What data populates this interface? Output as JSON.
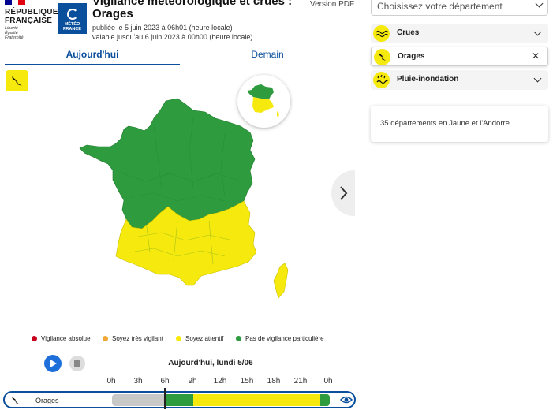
{
  "header": {
    "republic_name_line1": "RÉPUBLIQUE",
    "republic_name_line2": "FRANÇAISE",
    "motto_1": "Liberté",
    "motto_2": "Égalité",
    "motto_3": "Fraternité",
    "meteo_logo_line1": "MÉTÉO",
    "meteo_logo_line2": "FRANCE",
    "title": "Vigilance météorologique et crues :",
    "subtitle": "Orages",
    "published": "publiée le 5 juin 2023 à 06h01 (heure locale)",
    "valid_until": "valable jusqu'au 6 juin 2023 à 00h00 (heure locale)",
    "pdf_link": "Version PDF"
  },
  "tabs": [
    {
      "label": "Aujourd'hui",
      "active": true
    },
    {
      "label": "Demain",
      "active": false
    }
  ],
  "legend": [
    {
      "label": "Vigilance absolue",
      "color": "#c8001e"
    },
    {
      "label": "Soyez très vigilant",
      "color": "#f0a733"
    },
    {
      "label": "Soyez attentif",
      "color": "#f5e90e"
    },
    {
      "label": "Pas de vigilance particulière",
      "color": "#2e9b3e"
    }
  ],
  "timeline": {
    "date_label": "Aujourd'hui, lundi 5/06",
    "hours": [
      "0h",
      "3h",
      "6h",
      "9h",
      "12h",
      "15h",
      "18h",
      "21h",
      "0h"
    ],
    "phenomenon": "Orages",
    "current_hour": "6h"
  },
  "right_panel": {
    "select_placeholder": "Choisissez votre département",
    "phenomena": [
      {
        "label": "Crues",
        "icon": "waves-icon",
        "state": "collapsed"
      },
      {
        "label": "Orages",
        "icon": "lightning-icon",
        "state": "selected"
      },
      {
        "label": "Pluie-inondation",
        "icon": "rain-flood-icon",
        "state": "collapsed"
      }
    ],
    "summary": "35 départements en Jaune et l'Andorre"
  },
  "colors": {
    "green": "#2e9b3e",
    "yellow": "#f5e90e",
    "brand_blue": "#0a4f9c",
    "play_blue": "#1e6fd9"
  }
}
